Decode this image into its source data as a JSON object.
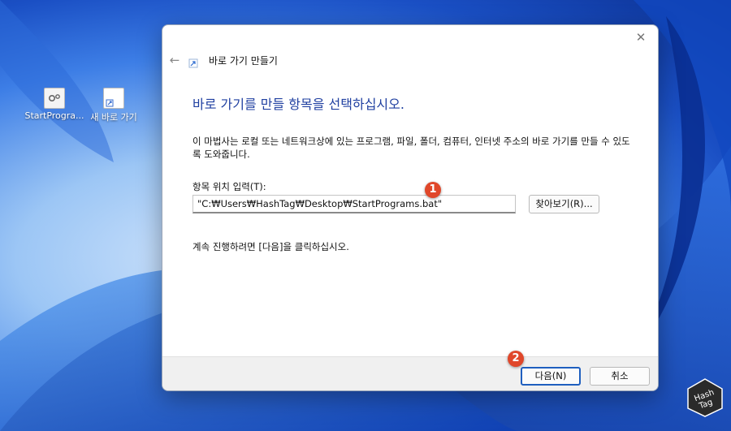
{
  "colors": {
    "heading": "#1f3fa0",
    "accent": "#1f5fbf",
    "badge": "#e0472a",
    "footer_bg": "#f0f0f0"
  },
  "desktop": {
    "icons": [
      {
        "label": "StartProgra...",
        "icon": "settings-script-icon"
      },
      {
        "label": "새 바로 가기",
        "icon": "shortcut-file-icon"
      }
    ]
  },
  "dialog": {
    "close_glyph": "✕",
    "back_glyph": "←",
    "title": "바로 가기 만들기",
    "heading": "바로 가기를 만들 항목을 선택하십시오.",
    "description": "이 마법사는 로컬 또는 네트워크상에 있는 프로그램, 파일, 폴더, 컴퓨터, 인터넷 주소의 바로 가기를 만들 수 있도록 도와줍니다.",
    "location_label": "항목 위치 입력(T):",
    "location_value": "\"C:₩Users₩HashTag₩Desktop₩StartPrograms.bat\"",
    "browse_label": "찾아보기(R)...",
    "continue_text": "계속 진행하려면 [다음]을 클릭하십시오.",
    "next_label": "다음(N)",
    "cancel_label": "취소"
  },
  "annotations": {
    "badge1": "1",
    "badge2": "2"
  },
  "logo": {
    "line1": "Hash",
    "line2": "Tag"
  }
}
